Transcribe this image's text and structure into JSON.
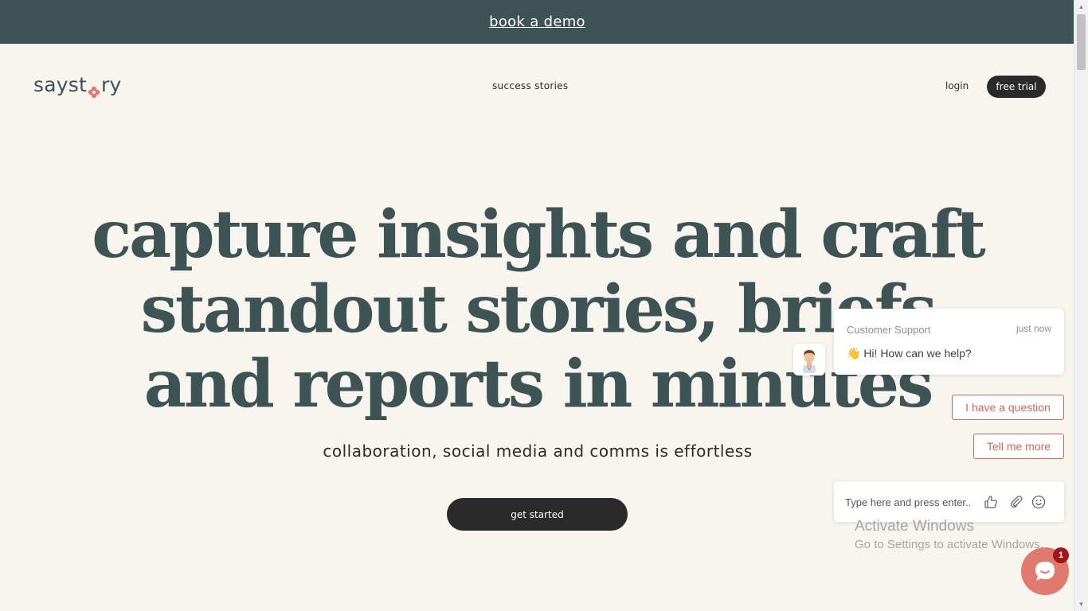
{
  "banner": {
    "link": "book a demo"
  },
  "nav": {
    "logo": "saystory",
    "logo_before": "sayst",
    "logo_after": "ry",
    "center_link": "success stories",
    "login": "login",
    "cta": "free trial"
  },
  "hero": {
    "line1": "capture insights and craft",
    "line2": "standout stories, briefs",
    "line3": "and reports in minutes",
    "subline": "collaboration, social media and comms is effortless",
    "cta": "get started"
  },
  "chat": {
    "sender": "Customer Support",
    "time": "just now",
    "message": "👋 Hi! How can we help?",
    "quick_replies": [
      "I have a question",
      "Tell me more"
    ],
    "input_placeholder": "Type here and press enter..",
    "badge_count": "1"
  },
  "system": {
    "activate_title": "Activate Windows",
    "activate_sub": "Go to Settings to activate Windows."
  },
  "colors": {
    "banner_bg": "#3d5354",
    "page_bg": "#f8f5ef",
    "heading": "#3d5354",
    "button_dark": "#2a2a2a",
    "accent_coral": "#d9645a"
  }
}
